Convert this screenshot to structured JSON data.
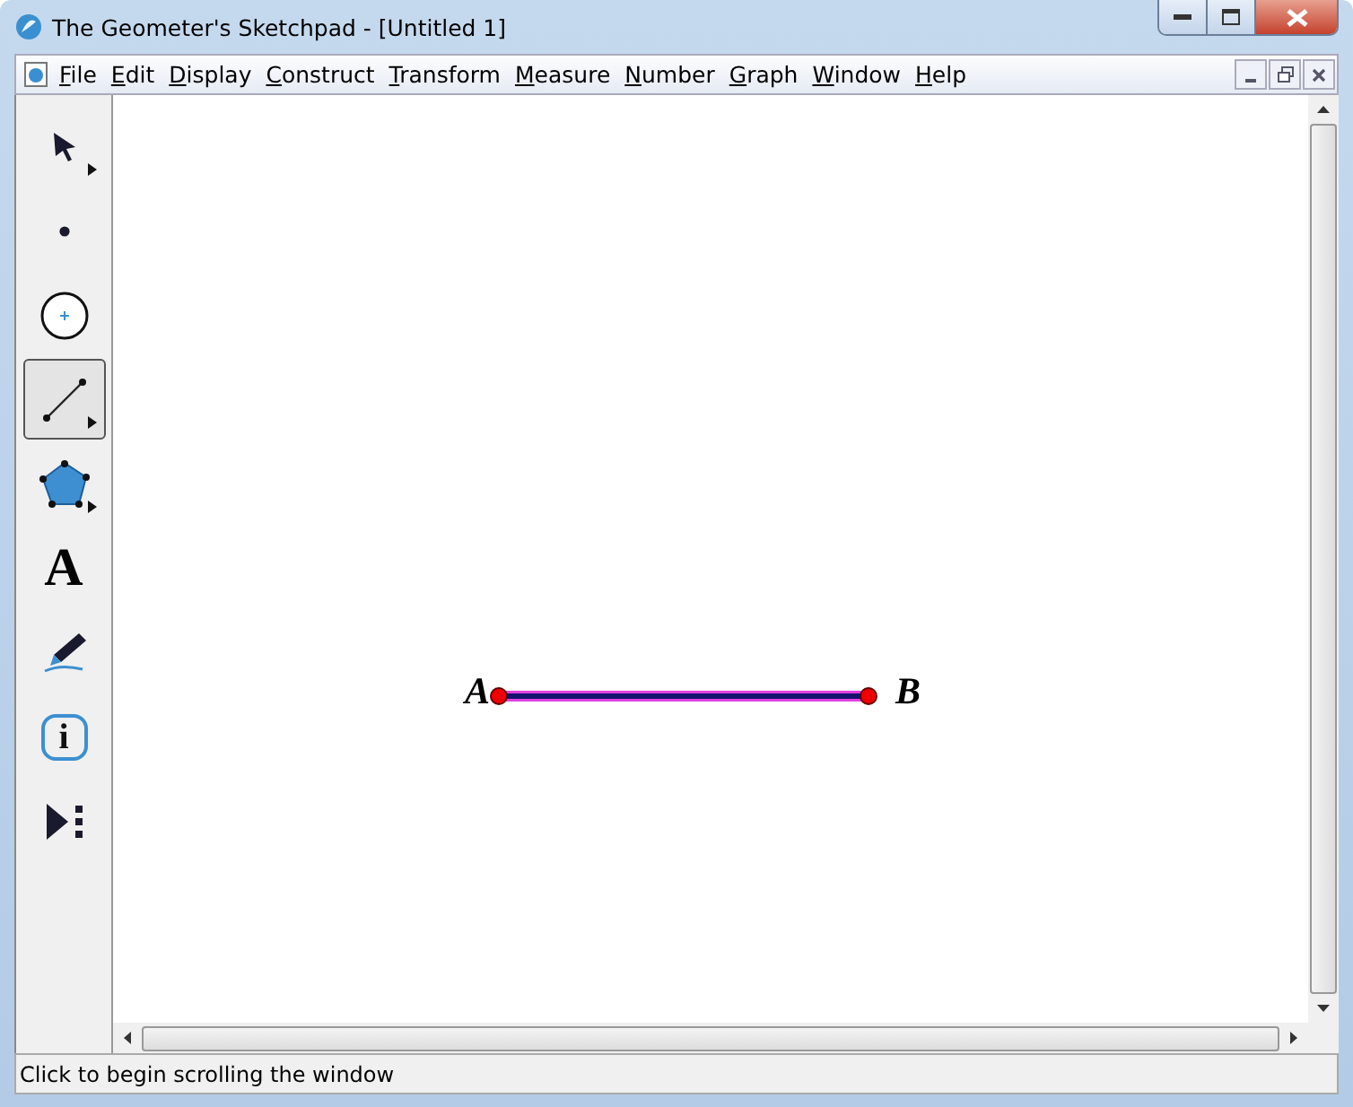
{
  "window": {
    "title": "The Geometer's Sketchpad - [Untitled 1]"
  },
  "menu": [
    "File",
    "Edit",
    "Display",
    "Construct",
    "Transform",
    "Measure",
    "Number",
    "Graph",
    "Window",
    "Help"
  ],
  "tools": [
    {
      "kind": "arrow",
      "selected": false,
      "submenu": true
    },
    {
      "kind": "point",
      "selected": false,
      "submenu": false
    },
    {
      "kind": "compass",
      "selected": false,
      "submenu": false
    },
    {
      "kind": "straightedge",
      "selected": true,
      "submenu": true
    },
    {
      "kind": "polygon",
      "selected": false,
      "submenu": true
    },
    {
      "kind": "text",
      "selected": false,
      "submenu": false,
      "glyph": "A"
    },
    {
      "kind": "marker",
      "selected": false,
      "submenu": false
    },
    {
      "kind": "info",
      "selected": false,
      "submenu": false,
      "glyph": "i"
    },
    {
      "kind": "custom",
      "selected": false,
      "submenu": false
    }
  ],
  "sketch": {
    "points": [
      {
        "label": "A"
      },
      {
        "label": "B"
      }
    ]
  },
  "status_bar": "Click to begin scrolling the window"
}
